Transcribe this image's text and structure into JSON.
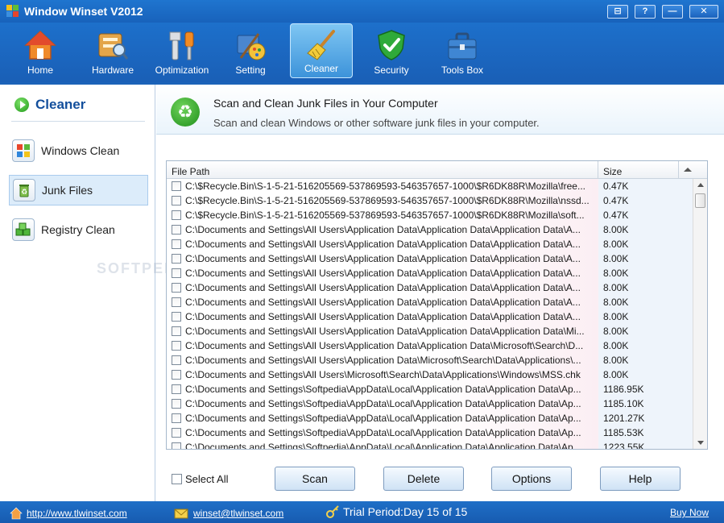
{
  "window": {
    "title": "Window Winset V2012",
    "buttons": [
      "⊟",
      "?",
      "—",
      "✕"
    ]
  },
  "toolbar": [
    {
      "label": "Home",
      "icon": "home-icon"
    },
    {
      "label": "Hardware",
      "icon": "hardware-icon"
    },
    {
      "label": "Optimization",
      "icon": "optimization-icon"
    },
    {
      "label": "Setting",
      "icon": "setting-icon"
    },
    {
      "label": "Cleaner",
      "icon": "cleaner-broom-icon",
      "active": true
    },
    {
      "label": "Security",
      "icon": "security-shield-icon"
    },
    {
      "label": "Tools Box",
      "icon": "toolbox-icon"
    }
  ],
  "sidebar": {
    "title": "Cleaner",
    "items": [
      {
        "label": "Windows Clean",
        "icon": "windows-logo-icon"
      },
      {
        "label": "Junk Files",
        "icon": "junk-recycle-icon",
        "active": true
      },
      {
        "label": "Registry Clean",
        "icon": "registry-cubes-icon"
      }
    ]
  },
  "header": {
    "title": "Scan and Clean Junk Files in Your Computer",
    "subtitle": "Scan and clean Windows or other software junk files in your computer."
  },
  "table": {
    "columns": [
      "File Path",
      "Size"
    ],
    "rows": [
      {
        "path": "C:\\$Recycle.Bin\\S-1-5-21-516205569-537869593-546357657-1000\\$R6DK88R\\Mozilla\\free...",
        "size": "0.47K"
      },
      {
        "path": "C:\\$Recycle.Bin\\S-1-5-21-516205569-537869593-546357657-1000\\$R6DK88R\\Mozilla\\nssd...",
        "size": "0.47K"
      },
      {
        "path": "C:\\$Recycle.Bin\\S-1-5-21-516205569-537869593-546357657-1000\\$R6DK88R\\Mozilla\\soft...",
        "size": "0.47K"
      },
      {
        "path": "C:\\Documents and Settings\\All Users\\Application Data\\Application Data\\Application Data\\A...",
        "size": "8.00K"
      },
      {
        "path": "C:\\Documents and Settings\\All Users\\Application Data\\Application Data\\Application Data\\A...",
        "size": "8.00K"
      },
      {
        "path": "C:\\Documents and Settings\\All Users\\Application Data\\Application Data\\Application Data\\A...",
        "size": "8.00K"
      },
      {
        "path": "C:\\Documents and Settings\\All Users\\Application Data\\Application Data\\Application Data\\A...",
        "size": "8.00K"
      },
      {
        "path": "C:\\Documents and Settings\\All Users\\Application Data\\Application Data\\Application Data\\A...",
        "size": "8.00K"
      },
      {
        "path": "C:\\Documents and Settings\\All Users\\Application Data\\Application Data\\Application Data\\A...",
        "size": "8.00K"
      },
      {
        "path": "C:\\Documents and Settings\\All Users\\Application Data\\Application Data\\Application Data\\A...",
        "size": "8.00K"
      },
      {
        "path": "C:\\Documents and Settings\\All Users\\Application Data\\Application Data\\Application Data\\Mi...",
        "size": "8.00K"
      },
      {
        "path": "C:\\Documents and Settings\\All Users\\Application Data\\Application Data\\Microsoft\\Search\\D...",
        "size": "8.00K"
      },
      {
        "path": "C:\\Documents and Settings\\All Users\\Application Data\\Microsoft\\Search\\Data\\Applications\\...",
        "size": "8.00K"
      },
      {
        "path": "C:\\Documents and Settings\\All Users\\Microsoft\\Search\\Data\\Applications\\Windows\\MSS.chk",
        "size": "8.00K"
      },
      {
        "path": "C:\\Documents and Settings\\Softpedia\\AppData\\Local\\Application Data\\Application Data\\Ap...",
        "size": "1186.95K"
      },
      {
        "path": "C:\\Documents and Settings\\Softpedia\\AppData\\Local\\Application Data\\Application Data\\Ap...",
        "size": "1185.10K"
      },
      {
        "path": "C:\\Documents and Settings\\Softpedia\\AppData\\Local\\Application Data\\Application Data\\Ap...",
        "size": "1201.27K"
      },
      {
        "path": "C:\\Documents and Settings\\Softpedia\\AppData\\Local\\Application Data\\Application Data\\Ap...",
        "size": "1185.53K"
      },
      {
        "path": "C:\\Documents and Settings\\Softpedia\\AppData\\Local\\Application Data\\Application Data\\Ap...",
        "size": "1223.55K"
      }
    ]
  },
  "controls": {
    "select_all": "Select All",
    "buttons": [
      "Scan",
      "Delete",
      "Options",
      "Help"
    ]
  },
  "status": {
    "website": "http://www.tlwinset.com",
    "email": "winset@tlwinset.com",
    "trial": "Trial Period:Day 15 of 15",
    "buy": "Buy Now"
  },
  "watermark": "SOFTPEDIA",
  "colors": {
    "titlebar": "#1f75cf",
    "accent": "#134f9c",
    "active_tab": "#3d93da"
  }
}
